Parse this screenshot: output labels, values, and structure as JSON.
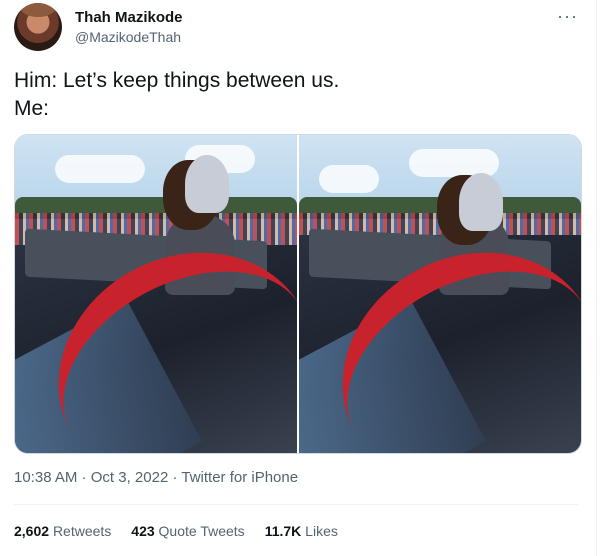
{
  "author": {
    "name": "Thah Mazikode",
    "handle": "@MazikodeThah",
    "avatar_icon": "profile-photo"
  },
  "more_button": {
    "icon": "ellipsis-icon",
    "label": "···"
  },
  "tweet_text": {
    "line1": "Him: Let’s keep things between us.",
    "line2": "Me:"
  },
  "media": {
    "count": 2,
    "icons": [
      "photo-woman-in-car-sunroof-1",
      "photo-woman-in-car-sunroof-2"
    ]
  },
  "meta": {
    "time": "10:38 AM",
    "separator1": " · ",
    "date": "Oct 3, 2022",
    "separator2": " · ",
    "source": "Twitter for iPhone"
  },
  "stats": {
    "retweets_count": "2,602",
    "retweets_label": "Retweets",
    "quotes_count": "423",
    "quotes_label": "Quote Tweets",
    "likes_count": "11.7K",
    "likes_label": "Likes"
  },
  "colors": {
    "text_primary": "#0f1419",
    "text_secondary": "#536471",
    "border": "#cfd9de",
    "car_red": "#c8232c"
  }
}
